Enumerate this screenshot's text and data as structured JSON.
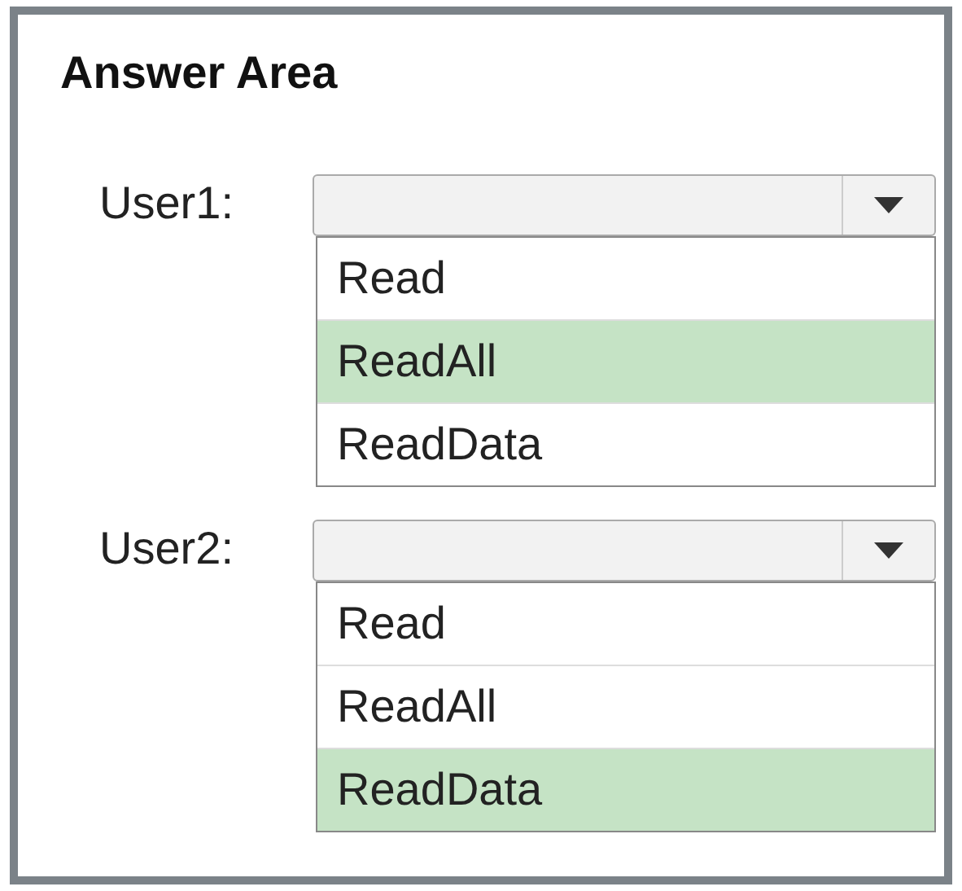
{
  "title": "Answer Area",
  "questions": [
    {
      "label": "User1:",
      "options": [
        {
          "label": "Read",
          "selected": false
        },
        {
          "label": "ReadAll",
          "selected": true
        },
        {
          "label": "ReadData",
          "selected": false
        }
      ]
    },
    {
      "label": "User2:",
      "options": [
        {
          "label": "Read",
          "selected": false
        },
        {
          "label": "ReadAll",
          "selected": false
        },
        {
          "label": "ReadData",
          "selected": true
        }
      ]
    }
  ]
}
